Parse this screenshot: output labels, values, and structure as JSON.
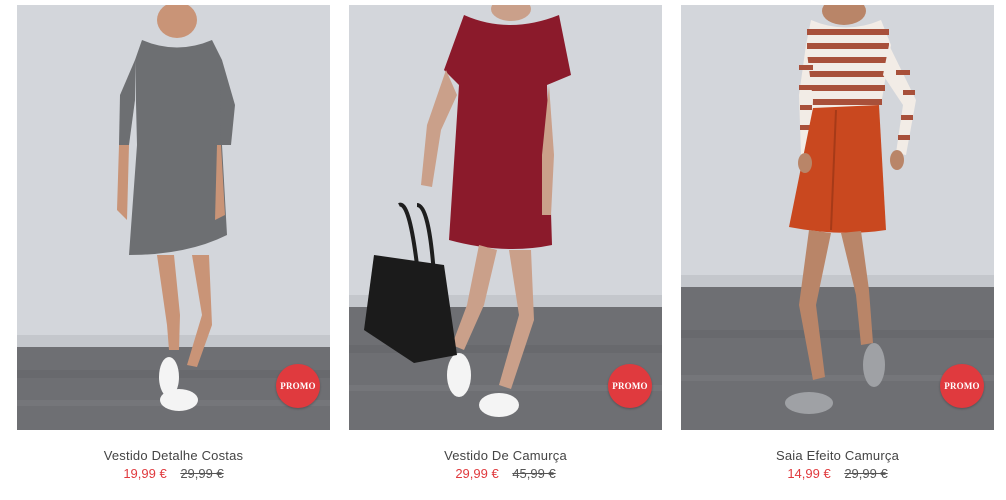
{
  "products": [
    {
      "name": "Vestido Detalhe Costas",
      "price": "19,99 €",
      "old_price": "29,99 €",
      "badge": "PROMO",
      "image": "grey-knit-dress-model"
    },
    {
      "name": "Vestido De Camurça",
      "price": "29,99 €",
      "old_price": "45,99 €",
      "badge": "PROMO",
      "image": "burgundy-suede-dress-model-with-black-bag"
    },
    {
      "name": "Saia Efeito Camurça",
      "price": "14,99 €",
      "old_price": "29,99 €",
      "badge": "PROMO",
      "image": "orange-suede-skirt-striped-top-model"
    }
  ],
  "colors": {
    "promo_badge": "#e03a3e",
    "sale_price": "#e03a3e",
    "old_price": "#555555",
    "title": "#444444"
  }
}
